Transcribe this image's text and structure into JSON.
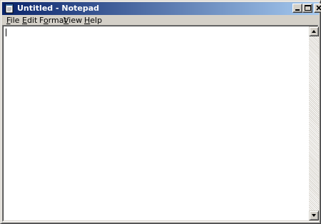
{
  "window": {
    "title": "Untitled - Notepad",
    "icon": "notepad-icon",
    "controls": [
      "minimize-icon",
      "maximize-icon",
      "close-icon"
    ]
  },
  "menu": {
    "items": [
      {
        "label": "File",
        "accel": "F",
        "rest": "ile"
      },
      {
        "label": "Edit",
        "accel": "E",
        "rest": "dit"
      },
      {
        "label": "Format",
        "accel": "o",
        "pre": "F",
        "rest": "rmat"
      },
      {
        "label": "View",
        "accel": "V",
        "rest": "iew"
      },
      {
        "label": "Help",
        "accel": "H",
        "rest": "elp"
      }
    ]
  },
  "editor": {
    "content": ""
  },
  "colors": {
    "title_start": "#0a246a",
    "title_end": "#a6caf0",
    "face": "#d4d0c8"
  }
}
